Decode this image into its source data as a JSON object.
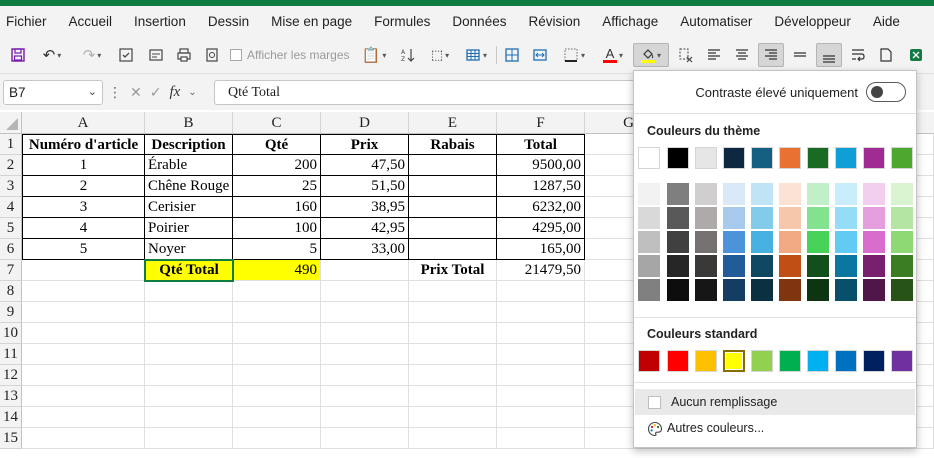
{
  "menu": [
    "Fichier",
    "Accueil",
    "Insertion",
    "Dessin",
    "Mise en page",
    "Formules",
    "Données",
    "Révision",
    "Affichage",
    "Automatiser",
    "Développeur",
    "Aide"
  ],
  "ribbon": {
    "show_margins_label": "Afficher les marges",
    "font_color_letter": "A"
  },
  "formula_bar": {
    "name_box": "B7",
    "fx_label": "fx",
    "content": "Qté Total"
  },
  "columns": [
    "A",
    "B",
    "C",
    "D",
    "E",
    "F",
    "G"
  ],
  "rows": [
    "1",
    "2",
    "3",
    "4",
    "5",
    "6",
    "7",
    "8",
    "9",
    "10",
    "11",
    "12",
    "13",
    "14",
    "15"
  ],
  "table": {
    "headers": [
      "Numéro d'article",
      "Description",
      "Qté",
      "Prix",
      "Rabais",
      "Total"
    ],
    "rows": [
      [
        "1",
        "Érable",
        "200",
        "47,50",
        "",
        "9500,00"
      ],
      [
        "2",
        "Chêne Rouge",
        "25",
        "51,50",
        "",
        "1287,50"
      ],
      [
        "3",
        "Cerisier",
        "160",
        "38,95",
        "",
        "6232,00"
      ],
      [
        "4",
        "Poirier",
        "100",
        "42,95",
        "",
        "4295,00"
      ],
      [
        "5",
        "Noyer",
        "5",
        "33,00",
        "",
        "165,00"
      ]
    ],
    "qty_total_label": "Qté Total",
    "qty_total_value": "490",
    "price_total_label": "Prix Total",
    "price_total_value": "21479,50"
  },
  "fill_dropdown": {
    "contrast_label": "Contraste élevé uniquement",
    "theme_title": "Couleurs du thème",
    "standard_title": "Couleurs standard",
    "no_fill_label": "Aucun remplissage",
    "more_colors_label": "Autres couleurs...",
    "theme_colors": [
      "#ffffff",
      "#000000",
      "#e7e6e6",
      "#0e2841",
      "#156082",
      "#e97132",
      "#196b24",
      "#0f9ed5",
      "#a02b93",
      "#4ea72e"
    ],
    "theme_shades": [
      [
        "#f2f2f2",
        "#7f7f7f",
        "#d0cece",
        "#dae9f8",
        "#c0e4f5",
        "#fbe2d5",
        "#c1f0c8",
        "#caedfb",
        "#f2ceef",
        "#d9f2d0"
      ],
      [
        "#d9d9d9",
        "#595959",
        "#aeaaaa",
        "#a6c9ec",
        "#83cbeb",
        "#f7c7ac",
        "#83e28e",
        "#95dcf7",
        "#e59edd",
        "#b4e5a2"
      ],
      [
        "#bfbfbf",
        "#404040",
        "#767171",
        "#4d93d9",
        "#45b0e1",
        "#f1a983",
        "#47d359",
        "#61cbf3",
        "#d86dcd",
        "#8ed973"
      ],
      [
        "#a6a6a6",
        "#262626",
        "#3b3838",
        "#215c98",
        "#104862",
        "#c04f15",
        "#124f1a",
        "#0b76a0",
        "#78206e",
        "#3b7d23"
      ],
      [
        "#808080",
        "#0d0d0d",
        "#171616",
        "#153d64",
        "#0a3041",
        "#7f350e",
        "#0d3512",
        "#074f6a",
        "#501549",
        "#275317"
      ]
    ],
    "standard_colors": [
      "#c00000",
      "#ff0000",
      "#ffc000",
      "#ffff00",
      "#92d050",
      "#00b050",
      "#00b0f0",
      "#0070c0",
      "#002060",
      "#7030a0"
    ],
    "selected_standard_index": 3
  }
}
